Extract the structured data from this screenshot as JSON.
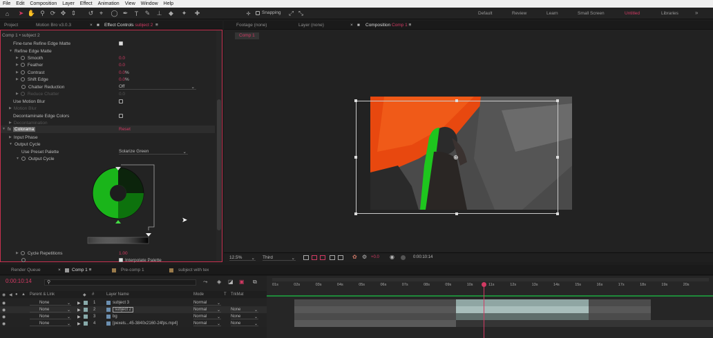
{
  "menu": [
    "File",
    "Edit",
    "Composition",
    "Layer",
    "Effect",
    "Animation",
    "View",
    "Window",
    "Help"
  ],
  "toolbar": {
    "snapping": "Snapping"
  },
  "workspaces": [
    "Default",
    "Review",
    "Learn",
    "Small Screen",
    "Untitled",
    "Libraries"
  ],
  "left_tabs": {
    "project": "Project",
    "plugin": "Motion Bro v3.0.3",
    "effect_controls": "Effect Controls",
    "effect_target": "subject 2"
  },
  "left_path": "Comp 1 • subject 2",
  "effects": {
    "fine_tune": "Fine-tune Refine Edge Matte",
    "refine_edge": "Refine Edge Matte",
    "smooth": {
      "label": "Smooth",
      "value": "0.0"
    },
    "feather": {
      "label": "Feather",
      "value": "0.0"
    },
    "contrast": {
      "label": "Contrast",
      "value": "0.0",
      "unit": "%"
    },
    "shift_edge": {
      "label": "Shift Edge",
      "value": "0.0",
      "unit": "%"
    },
    "chatter": {
      "label": "Chatter Reduction",
      "value": "Off"
    },
    "reduce_chatter": {
      "label": "Reduce Chatter",
      "value": "0.0"
    },
    "motion_blur": "Use Motion Blur",
    "motion_blur_sub": "Motion Blur",
    "decontaminate": "Decontaminate Edge Colors",
    "decontam_sub": "Decontamination",
    "colorama": "Colorama",
    "colorama_reset": "Reset",
    "input_phase": "Input Phase",
    "output_cycle": "Output Cycle",
    "preset_label": "Use Preset Palette",
    "preset_value": "Solarize Green",
    "output_cycle_sub": "Output Cycle",
    "cycle_reps": {
      "label": "Cycle Repetitions",
      "value": "1.00"
    },
    "interpolate": "Interpolate Palette"
  },
  "center_tabs": {
    "footage": "Footage (none)",
    "layer": "Layer (none)",
    "composition": "Composition",
    "comp_name": "Comp 1"
  },
  "comp_chip": "Comp 1",
  "viewer_bar": {
    "zoom": "12.5%",
    "res": "Third",
    "timecode": "0:00:10:14"
  },
  "timeline_tabs": {
    "render": "Render Queue",
    "comp1": "Comp 1",
    "precomp": "Pre-comp 1",
    "subject_text": "subject with tex"
  },
  "timecode": "0:00:10:14",
  "layer_headers": {
    "parent": "Parent & Link",
    "num": "#",
    "name": "Layer Name",
    "mode": "Mode",
    "t": "T",
    "trkmat": "TrkMat"
  },
  "layers": [
    {
      "num": "1",
      "name": "subject 3",
      "parent": "None",
      "mode": "Normal",
      "trkmat": ""
    },
    {
      "num": "2",
      "name": "subject 2",
      "parent": "None",
      "mode": "Normal",
      "trkmat": "None"
    },
    {
      "num": "3",
      "name": "bg",
      "parent": "None",
      "mode": "Normal",
      "trkmat": "None"
    },
    {
      "num": "4",
      "name": "[pexels...45-3840x2160-24fps.mp4]",
      "parent": "None",
      "mode": "Normal",
      "trkmat": "None"
    }
  ],
  "ruler": [
    "01s",
    "02s",
    "03s",
    "04s",
    "05s",
    "06s",
    "07s",
    "08s",
    "09s",
    "10s",
    "11s",
    "12s",
    "13s",
    "14s",
    "15s",
    "16s",
    "17s",
    "18s",
    "19s",
    "20s"
  ]
}
